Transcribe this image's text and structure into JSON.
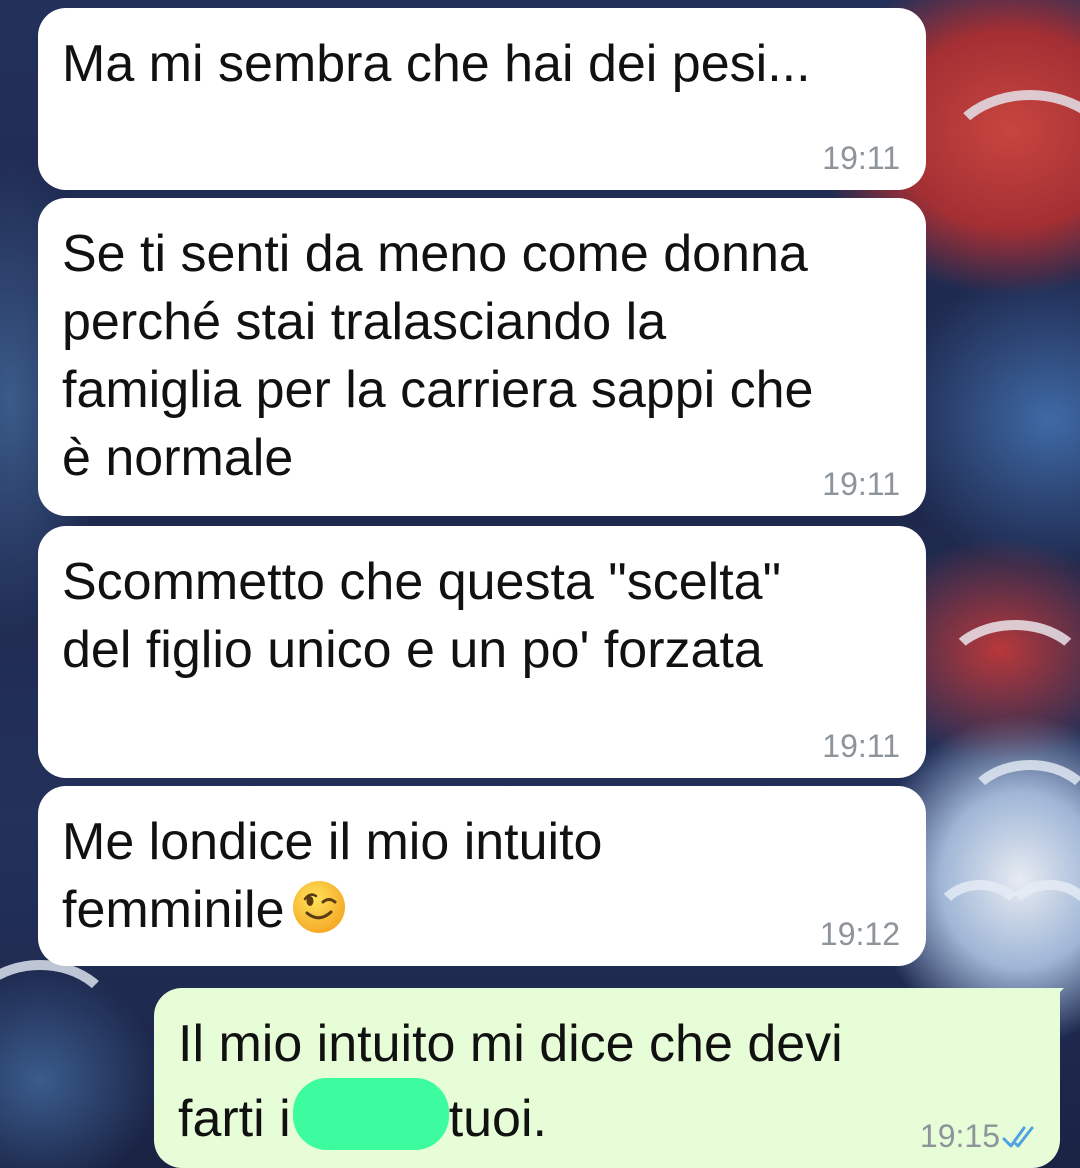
{
  "chat": {
    "messages": [
      {
        "direction": "incoming",
        "text": "Ma mi sembra che hai dei pesi...",
        "time": "19:11"
      },
      {
        "direction": "incoming",
        "text": "Se ti senti da meno come donna\nperché stai tralasciando la\nfamiglia per la carriera sappi che\nè normale",
        "time": "19:11"
      },
      {
        "direction": "incoming",
        "text": "Scommetto che questa \"scelta\"\ndel figlio unico e un po' forzata",
        "time": "19:11"
      },
      {
        "direction": "incoming",
        "text_line1": "Me londice il mio intuito",
        "text_line2": "femminile",
        "emoji": "winking-face",
        "time": "19:12"
      },
      {
        "direction": "outgoing",
        "text_line1": "Il mio intuito mi dice che devi",
        "text_line2_start": "farti i",
        "text_line2_end": "tuoi.",
        "time": "19:15",
        "status": "read-double-check"
      }
    ]
  },
  "colors": {
    "incoming_bubble": "#ffffff",
    "outgoing_bubble": "#e7fdd8",
    "timestamp": "#8d949a",
    "read_ticks": "#4fa3e0",
    "redaction": "#3dfc9f"
  }
}
